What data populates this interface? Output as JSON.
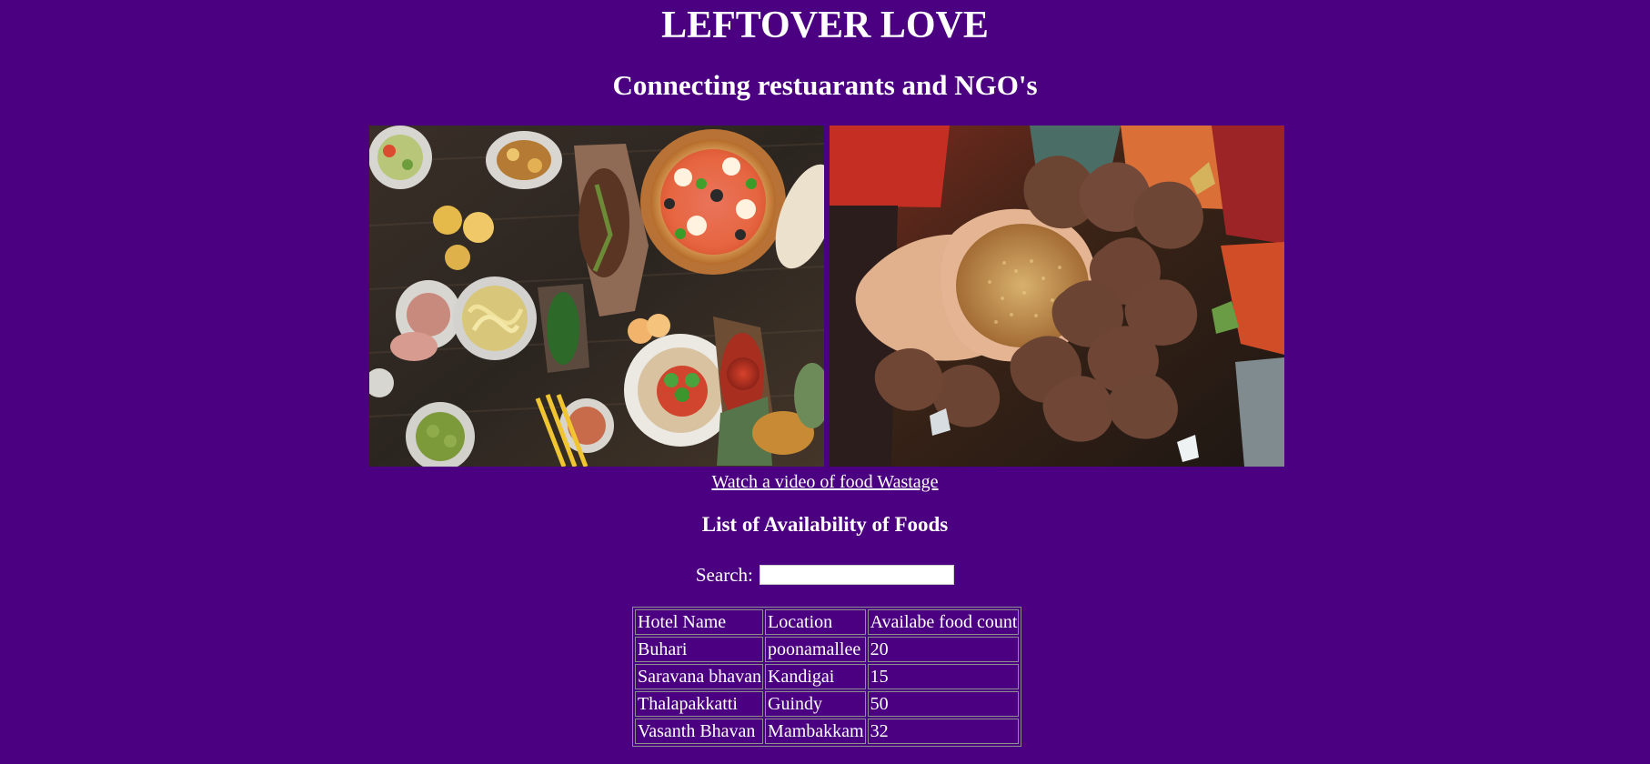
{
  "header": {
    "title": "LEFTOVER LOVE",
    "subtitle": "Connecting restuarants and NGO's"
  },
  "images": {
    "left": "food-spread-photo",
    "right": "hands-receiving-grain-photo"
  },
  "video_link": {
    "label": "Watch a video of food Wastage"
  },
  "food_list": {
    "title": "List of Availability of Foods",
    "search_label": "Search:",
    "search_value": "",
    "columns": [
      "Hotel Name",
      "Location",
      "Availabe food count"
    ],
    "rows": [
      [
        "Buhari",
        "poonamallee",
        "20"
      ],
      [
        "Saravana bhavan",
        "Kandigai",
        "15"
      ],
      [
        "Thalapakkatti",
        "Guindy",
        "50"
      ],
      [
        "Vasanth Bhavan",
        "Mambakkam",
        "32"
      ]
    ]
  },
  "colors": {
    "background": "#4b0082",
    "text": "#ffffff",
    "table_border": "#8e8e8e"
  }
}
